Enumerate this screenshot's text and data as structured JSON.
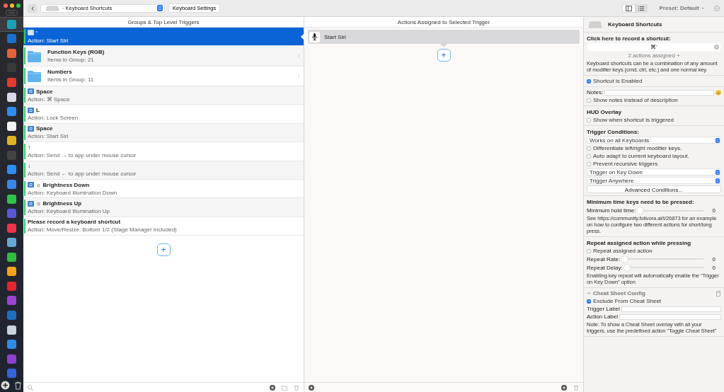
{
  "dock": {
    "label": ">>>"
  },
  "toolbar": {
    "breadcrumb": "· Keyboard Shortcuts",
    "settings_button": "Keyboard Settings",
    "preset": "Preset: Default",
    "view_modes": [
      {
        "kind": "columns",
        "selected": true
      },
      {
        "kind": "list",
        "selected": false
      }
    ]
  },
  "triggers": {
    "header": "Groups & Top Level Triggers",
    "items": [
      {
        "kind": "shortcut",
        "badge": true,
        "title": "'",
        "subtitle": "Action: Start Siri",
        "selected": true,
        "enabled": true
      },
      {
        "kind": "folder",
        "title": "Function Keys (RGB)",
        "subtitle": "Items in Group: 21",
        "selected": false,
        "enabled": true
      },
      {
        "kind": "folder",
        "title": "Numbers",
        "subtitle": "Items in Group: 11",
        "selected": false,
        "enabled": true
      },
      {
        "kind": "shortcut",
        "badge": true,
        "title": "Space",
        "subtitle": "Action: ⌘ Space",
        "selected": false,
        "enabled": true
      },
      {
        "kind": "shortcut",
        "badge": true,
        "title": "L",
        "subtitle": "Action: Lock Screen",
        "selected": false,
        "enabled": true
      },
      {
        "kind": "shortcut",
        "badge": true,
        "title": "Space",
        "subtitle": "Action: Start Siri",
        "selected": false,
        "enabled": true
      },
      {
        "kind": "shortcut",
        "badge": false,
        "title": "↑",
        "subtitle": "Action: Send  → to app under mouse cursor",
        "selected": false,
        "enabled": true
      },
      {
        "kind": "shortcut",
        "badge": false,
        "title": "↓",
        "subtitle": "Action: Send  ← to app under mouse cursor",
        "selected": false,
        "enabled": true
      },
      {
        "kind": "shortcut",
        "badge": true,
        "title": "☼ Brightness Down",
        "subtitle": "Action: Keyboard Illumination Down",
        "selected": false,
        "enabled": true
      },
      {
        "kind": "shortcut",
        "badge": true,
        "title": "☼ Brightness Up",
        "subtitle": "Action: Keyboard Illumination Up",
        "selected": false,
        "enabled": true
      },
      {
        "kind": "shortcut",
        "badge": false,
        "title": "Please record a keyboard shortcut",
        "subtitle": "Action: Move/Resize: Bottom 1/2 (Stage Manager Included)",
        "selected": false,
        "enabled": true
      }
    ],
    "add_button": "+"
  },
  "actions": {
    "header": "Actions Assigned to Selected Trigger",
    "items": [
      {
        "label": "Start Siri",
        "selected": true
      }
    ],
    "add_button": "+"
  },
  "inspector": {
    "title": "Keyboard Shortcuts",
    "sections": [
      [
        {
          "kind": "heading",
          "text": "Click here to record a shortcut:"
        },
        {
          "kind": "shortcut-field",
          "value": "⌘'"
        },
        {
          "kind": "link",
          "text": "2 actions assigned +"
        },
        {
          "kind": "note",
          "text": "Keyboard shortcuts can be a combination of any amount of modifier keys (cmd, ctrl, etc.) and one normal key."
        }
      ],
      [
        {
          "kind": "checkbox",
          "text": "Shortcut is Enabled",
          "checked": true
        }
      ],
      [
        {
          "kind": "text-field",
          "label": "Notes:",
          "emoji": true
        },
        {
          "kind": "checkbox",
          "text": "Show notes instead of description",
          "checked": false
        }
      ],
      [
        {
          "kind": "heading",
          "text": "HUD Overlay"
        },
        {
          "kind": "checkbox",
          "text": "Show when shortcut is triggered",
          "checked": false
        }
      ],
      [
        {
          "kind": "heading",
          "text": "Trigger Conditions:"
        },
        {
          "kind": "select",
          "value": "Works on all Keyboards"
        },
        {
          "kind": "checkbox",
          "text": "Differentiate left/right modifier keys.",
          "checked": false
        },
        {
          "kind": "checkbox",
          "text": "Auto adapt to current keyboard layout.",
          "checked": false
        },
        {
          "kind": "checkbox",
          "text": "Prevent recursive triggers",
          "checked": false
        },
        {
          "kind": "select",
          "value": "Trigger on Key Down"
        },
        {
          "kind": "select",
          "value": "Trigger Anywhere"
        },
        {
          "kind": "button",
          "text": "Advanced Conditions..."
        }
      ],
      [
        {
          "kind": "heading",
          "text": "Minimum time keys need to be pressed:"
        },
        {
          "kind": "slider",
          "label": "Minimum hold time:",
          "level": 0,
          "reading": "0"
        },
        {
          "kind": "note",
          "text": "See https://community.folivora.ai/t/26873 for an example on how to configure two different actions for short/long press."
        }
      ],
      [
        {
          "kind": "heading",
          "text": "Repeat assigned action while pressing"
        },
        {
          "kind": "checkbox",
          "text": "Repeat assigned action",
          "checked": false
        },
        {
          "kind": "slider",
          "label": "Repeat Rate:",
          "level": 0,
          "reading": "0"
        },
        {
          "kind": "slider",
          "label": "Repeat Delay:",
          "level": 0,
          "reading": "0"
        },
        {
          "kind": "note",
          "text": "Enabling key repeat will automatically enable the \"Trigger on Key Down\" option"
        }
      ],
      [
        {
          "kind": "collapsible",
          "text": "Cheat Sheet Config",
          "expanded": true
        },
        {
          "kind": "checkbox",
          "text": "Exclude From Cheat Sheet",
          "checked": true
        },
        {
          "kind": "text-field",
          "label": "Trigger Label",
          "emoji": false
        },
        {
          "kind": "text-field",
          "label": "Action Label",
          "emoji": false
        },
        {
          "kind": "note",
          "text": "Note: To show a Cheat Sheet overlay with all your triggers, use the predefined action \"Toggle Cheat Sheet\""
        }
      ]
    ]
  }
}
